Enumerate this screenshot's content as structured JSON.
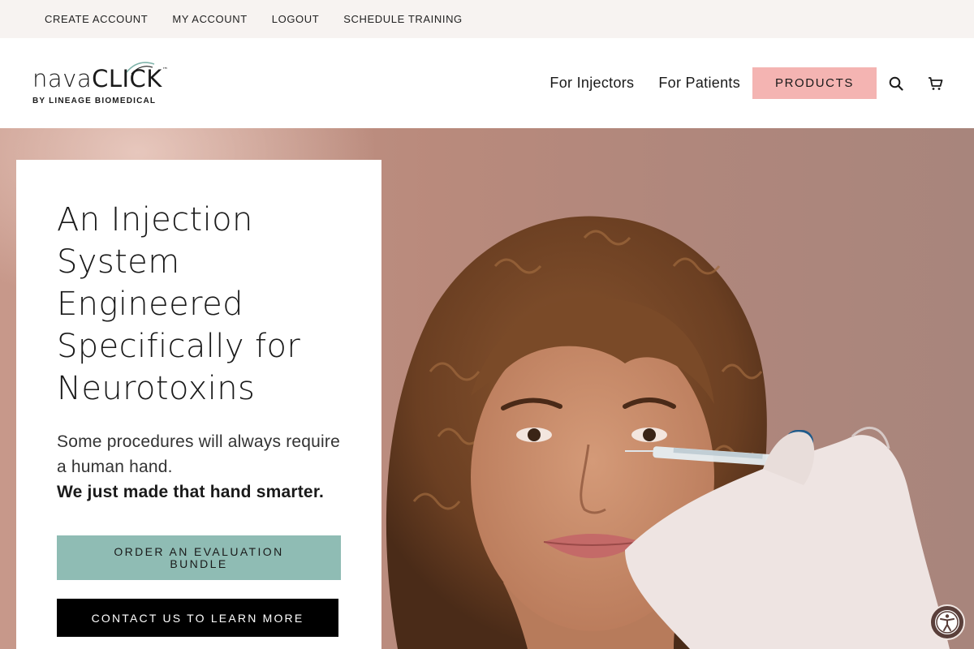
{
  "utility_nav": {
    "items": [
      "CREATE ACCOUNT",
      "MY ACCOUNT",
      "LOGOUT",
      "SCHEDULE TRAINING"
    ]
  },
  "logo": {
    "wordmark_light": "nava",
    "wordmark_strong": "CLICK",
    "trademark": "™",
    "tagline": "BY LINEAGE BIOMEDICAL"
  },
  "main_nav": {
    "injectors": "For Injectors",
    "patients": "For Patients",
    "products": "PRODUCTS"
  },
  "icons": {
    "search": "search-icon",
    "cart": "cart-icon",
    "accessibility": "accessibility-icon"
  },
  "hero": {
    "title_lines": [
      "An Injection",
      "System",
      "Engineered",
      "Specifically for",
      "Neurotoxins"
    ],
    "subtitle": "Some procedures will always require a human hand.",
    "subtitle_bold": "We just made that hand smarter.",
    "cta_primary": "ORDER AN EVALUATION BUNDLE",
    "cta_secondary": "CONTACT US TO LEARN MORE"
  },
  "colors": {
    "utility_bg": "#f7f3f1",
    "products_button": "#f4b4b2",
    "cta_primary": "#8fbcb4",
    "cta_secondary": "#000000",
    "hero_bg": "#b98a7c"
  }
}
